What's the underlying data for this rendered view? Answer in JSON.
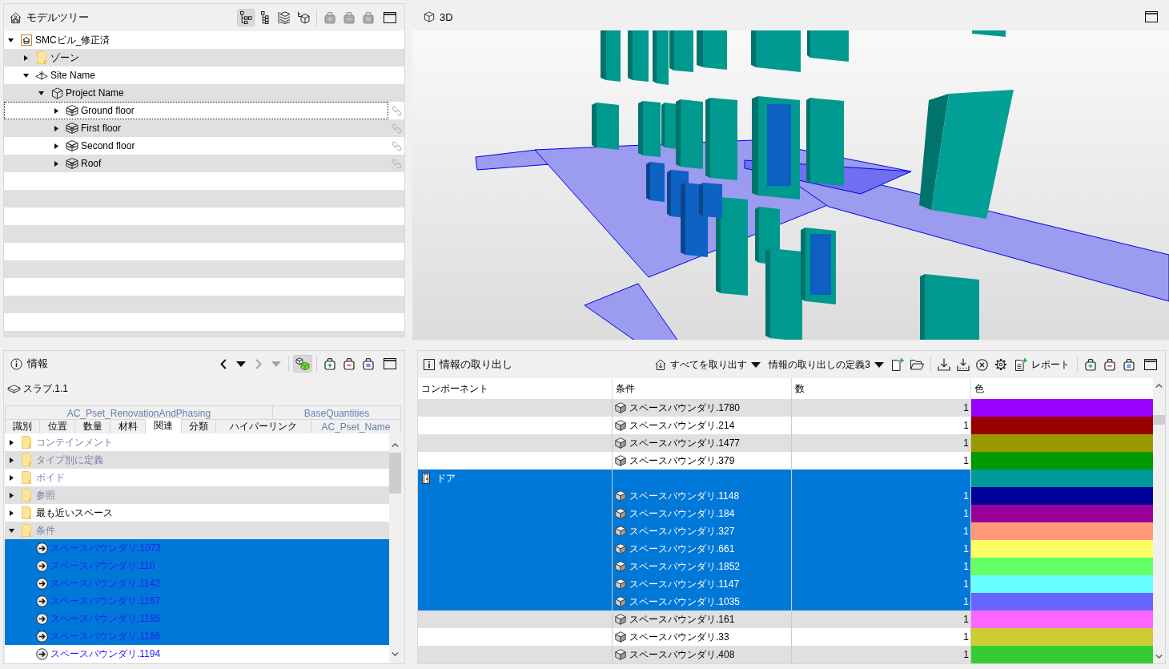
{
  "model_tree": {
    "title": "モデルツリー",
    "view_modes": [
      {
        "kind": "hierarchy",
        "selected": true
      },
      {
        "kind": "indent",
        "selected": false
      },
      {
        "kind": "layers",
        "selected": false
      },
      {
        "kind": "network",
        "selected": false
      }
    ],
    "set_actions": [
      {
        "kind": "add",
        "disabled": true
      },
      {
        "kind": "remove",
        "disabled": true
      },
      {
        "kind": "equal",
        "disabled": true
      }
    ],
    "items": [
      {
        "label": "SMCビル_修正済",
        "kind": "building",
        "expanded": true,
        "focused": false,
        "children": [
          {
            "label": "ゾーン",
            "kind": "folder",
            "expanded": false,
            "focused": false
          },
          {
            "label": "Site Name",
            "kind": "site",
            "expanded": true,
            "focused": false,
            "children": [
              {
                "label": "Project Name",
                "kind": "project",
                "expanded": true,
                "focused": false,
                "children": [
                  {
                    "label": "Ground floor",
                    "kind": "storey",
                    "expanded": false,
                    "focused": true
                  },
                  {
                    "label": "First floor",
                    "kind": "storey",
                    "expanded": false,
                    "focused": false
                  },
                  {
                    "label": "Second floor",
                    "kind": "storey",
                    "expanded": false,
                    "focused": false
                  },
                  {
                    "label": "Roof",
                    "kind": "storey",
                    "expanded": false,
                    "focused": false
                  }
                ]
              }
            ]
          }
        ]
      }
    ]
  },
  "viewport": {
    "title": "3D"
  },
  "info": {
    "title": "情報",
    "history": {
      "back_disabled": false,
      "forward_disabled": true
    },
    "highlight_on": true,
    "set_actions": [
      {
        "kind": "add",
        "disabled": false
      },
      {
        "kind": "remove",
        "disabled": false
      },
      {
        "kind": "equal",
        "disabled": false
      }
    ],
    "element": "スラブ.1.1",
    "tab_rows": [
      {
        "tabs": [
          {
            "label": "AC_Pset_RenovationAndPhasing",
            "custom": true,
            "selected": false
          },
          {
            "label": "BaseQuantities",
            "custom": true,
            "selected": false
          }
        ]
      },
      {
        "tabs": [
          {
            "label": "識別",
            "custom": false,
            "selected": false
          },
          {
            "label": "位置",
            "custom": false,
            "selected": false
          },
          {
            "label": "数量",
            "custom": false,
            "selected": false
          },
          {
            "label": "材料",
            "custom": false,
            "selected": false
          },
          {
            "label": "関連",
            "custom": false,
            "selected": true
          },
          {
            "label": "分類",
            "custom": false,
            "selected": false
          },
          {
            "label": "ハイパーリンク",
            "custom": false,
            "selected": false
          },
          {
            "label": "AC_Pset_Name",
            "custom": true,
            "selected": false
          }
        ]
      }
    ],
    "relations": [
      {
        "label": "コンテインメント",
        "dimmed": true,
        "expanded": false
      },
      {
        "label": "タイプ別に定義",
        "dimmed": true,
        "expanded": false
      },
      {
        "label": "ボイド",
        "dimmed": true,
        "expanded": false
      },
      {
        "label": "参照",
        "dimmed": true,
        "expanded": false
      },
      {
        "label": "最も近いスペース",
        "dimmed": false,
        "expanded": false
      },
      {
        "label": "条件",
        "dimmed": true,
        "expanded": true,
        "children": [
          {
            "label": "スペースバウンダリ.1073",
            "selected": true
          },
          {
            "label": "スペースバウンダリ.110",
            "selected": true
          },
          {
            "label": "スペースバウンダリ.1142",
            "selected": true
          },
          {
            "label": "スペースバウンダリ.1167",
            "selected": true
          },
          {
            "label": "スペースバウンダリ.1185",
            "selected": true
          },
          {
            "label": "スペースバウンダリ.1186",
            "selected": true
          },
          {
            "label": "スペースバウンダリ.1194",
            "selected": false
          }
        ]
      }
    ]
  },
  "extraction": {
    "title": "情報の取り出し",
    "extract_all": "すべてを取り出す",
    "definition": "情報の取り出しの定義3",
    "report": "レポート",
    "set_actions": [
      {
        "kind": "add",
        "disabled": false
      },
      {
        "kind": "remove",
        "disabled": false
      },
      {
        "kind": "equal",
        "disabled": false
      }
    ],
    "columns": [
      "コンポーネント",
      "条件",
      "数",
      "色"
    ],
    "rows": [
      {
        "kind": "item",
        "condition": "スペースバウンダリ.1780",
        "count": "1",
        "color": "#9900ff",
        "selected": false
      },
      {
        "kind": "item",
        "condition": "スペースバウンダリ.214",
        "count": "1",
        "color": "#990000",
        "selected": false
      },
      {
        "kind": "item",
        "condition": "スペースバウンダリ.1477",
        "count": "1",
        "color": "#999900",
        "selected": false
      },
      {
        "kind": "item",
        "condition": "スペースバウンダリ.379",
        "count": "1",
        "color": "#009900",
        "selected": false
      },
      {
        "kind": "group",
        "component": "ドア",
        "color": "#009999",
        "selected": true
      },
      {
        "kind": "item",
        "condition": "スペースバウンダリ.1148",
        "count": "1",
        "color": "#000099",
        "selected": true
      },
      {
        "kind": "item",
        "condition": "スペースバウンダリ.184",
        "count": "1",
        "color": "#990099",
        "selected": true
      },
      {
        "kind": "item",
        "condition": "スペースバウンダリ.327",
        "count": "1",
        "color": "#ff9977",
        "selected": true
      },
      {
        "kind": "item",
        "condition": "スペースバウンダリ.661",
        "count": "1",
        "color": "#ffff66",
        "selected": true
      },
      {
        "kind": "item",
        "condition": "スペースバウンダリ.1852",
        "count": "1",
        "color": "#66ff66",
        "selected": true
      },
      {
        "kind": "item",
        "condition": "スペースバウンダリ.1147",
        "count": "1",
        "color": "#66ffff",
        "selected": true
      },
      {
        "kind": "item",
        "condition": "スペースバウンダリ.1035",
        "count": "1",
        "color": "#6666ff",
        "selected": true
      },
      {
        "kind": "item",
        "condition": "スペースバウンダリ.161",
        "count": "1",
        "color": "#ff66ff",
        "selected": false
      },
      {
        "kind": "item",
        "condition": "スペースバウンダリ.33",
        "count": "1",
        "color": "#cccc33",
        "selected": false
      },
      {
        "kind": "item",
        "condition": "スペースバウンダリ.408",
        "count": "1",
        "color": "#33cc33",
        "selected": false
      }
    ]
  }
}
